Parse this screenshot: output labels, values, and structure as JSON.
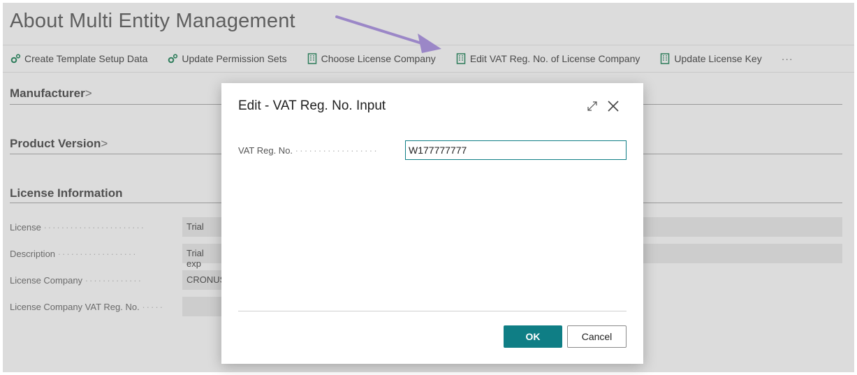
{
  "page": {
    "title": "About Multi Entity Management",
    "actions": [
      {
        "label": "Create Template Setup Data",
        "icon": "setup-gear-icon"
      },
      {
        "label": "Update Permission Sets",
        "icon": "setup-gear-icon"
      },
      {
        "label": "Choose License Company",
        "icon": "building-icon"
      },
      {
        "label": "Edit VAT Reg. No. of License Company",
        "icon": "building-icon"
      },
      {
        "label": "Update License Key",
        "icon": "building-icon"
      }
    ],
    "more_label": "···",
    "sections": {
      "manufacturer": "Manufacturer",
      "product_version": "Product Version",
      "license_information": "License Information"
    },
    "chevron": ">",
    "fields": [
      {
        "label": "License",
        "value": "Trial"
      },
      {
        "label": "Description",
        "value": "Trial exp"
      },
      {
        "label": "License Company",
        "value": "CRONUS"
      },
      {
        "label": "License Company VAT Reg. No.",
        "value": ""
      }
    ]
  },
  "dialog": {
    "title": "Edit - VAT Reg. No. Input",
    "field_label": "VAT Reg. No.",
    "field_value": "W177777777",
    "ok_label": "OK",
    "cancel_label": "Cancel"
  },
  "colors": {
    "accent": "#0f7e85",
    "annotation_arrow": "#9b87c7",
    "icon_green": "#2e7d5b"
  }
}
